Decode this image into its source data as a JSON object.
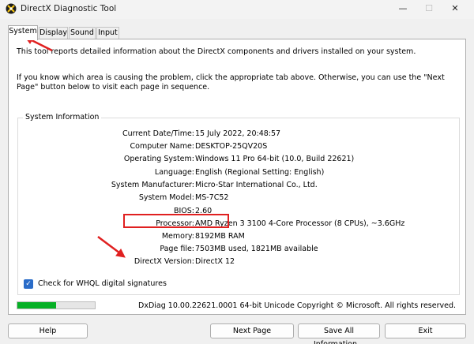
{
  "window": {
    "title": "DirectX Diagnostic Tool",
    "controls": {
      "minimize": "—",
      "maximize": "☐",
      "close": "✕"
    }
  },
  "tabs": [
    {
      "label": "System",
      "active": true
    },
    {
      "label": "Display",
      "active": false
    },
    {
      "label": "Sound",
      "active": false
    },
    {
      "label": "Input",
      "active": false
    }
  ],
  "intro": {
    "line1": "This tool reports detailed information about the DirectX components and drivers installed on your system.",
    "line2": "If you know which area is causing the problem, click the appropriate tab above.  Otherwise, you can use the \"Next Page\" button below to visit each page in sequence."
  },
  "system_info": {
    "title": "System Information",
    "rows": [
      {
        "label": "Current Date/Time:",
        "value": "15 July 2022, 20:48:57"
      },
      {
        "label": "Computer Name:",
        "value": "DESKTOP-25QV20S"
      },
      {
        "label": "Operating System:",
        "value": "Windows 11 Pro 64-bit (10.0, Build 22621)"
      },
      {
        "label": "Language:",
        "value": "English (Regional Setting: English)"
      },
      {
        "label": "System Manufacturer:",
        "value": "Micro-Star International Co., Ltd."
      },
      {
        "label": "System Model:",
        "value": "MS-7C52"
      },
      {
        "label": "BIOS:",
        "value": "2.60"
      },
      {
        "label": "Processor:",
        "value": "AMD Ryzen 3 3100 4-Core Processor",
        "extra": "(8 CPUs), ~3.6GHz"
      },
      {
        "label": "Memory:",
        "value": "8192MB RAM"
      },
      {
        "label": "Page file:",
        "value": "7503MB used, 1821MB available"
      },
      {
        "label": "DirectX Version:",
        "value": "DirectX 12"
      }
    ]
  },
  "whql": {
    "label": "Check for WHQL digital signatures",
    "checked": true,
    "check_glyph": "✓"
  },
  "progress": {
    "fraction": 0.5
  },
  "footer": {
    "version_text": "DxDiag 10.00.22621.0001 64-bit Unicode  Copyright © Microsoft. All rights reserved."
  },
  "buttons": {
    "help": "Help",
    "next": "Next Page",
    "save": "Save All Information...",
    "exit": "Exit"
  },
  "colors": {
    "accent": "#2a6cc8",
    "progress": "#06b025",
    "annotation": "#e02020"
  }
}
